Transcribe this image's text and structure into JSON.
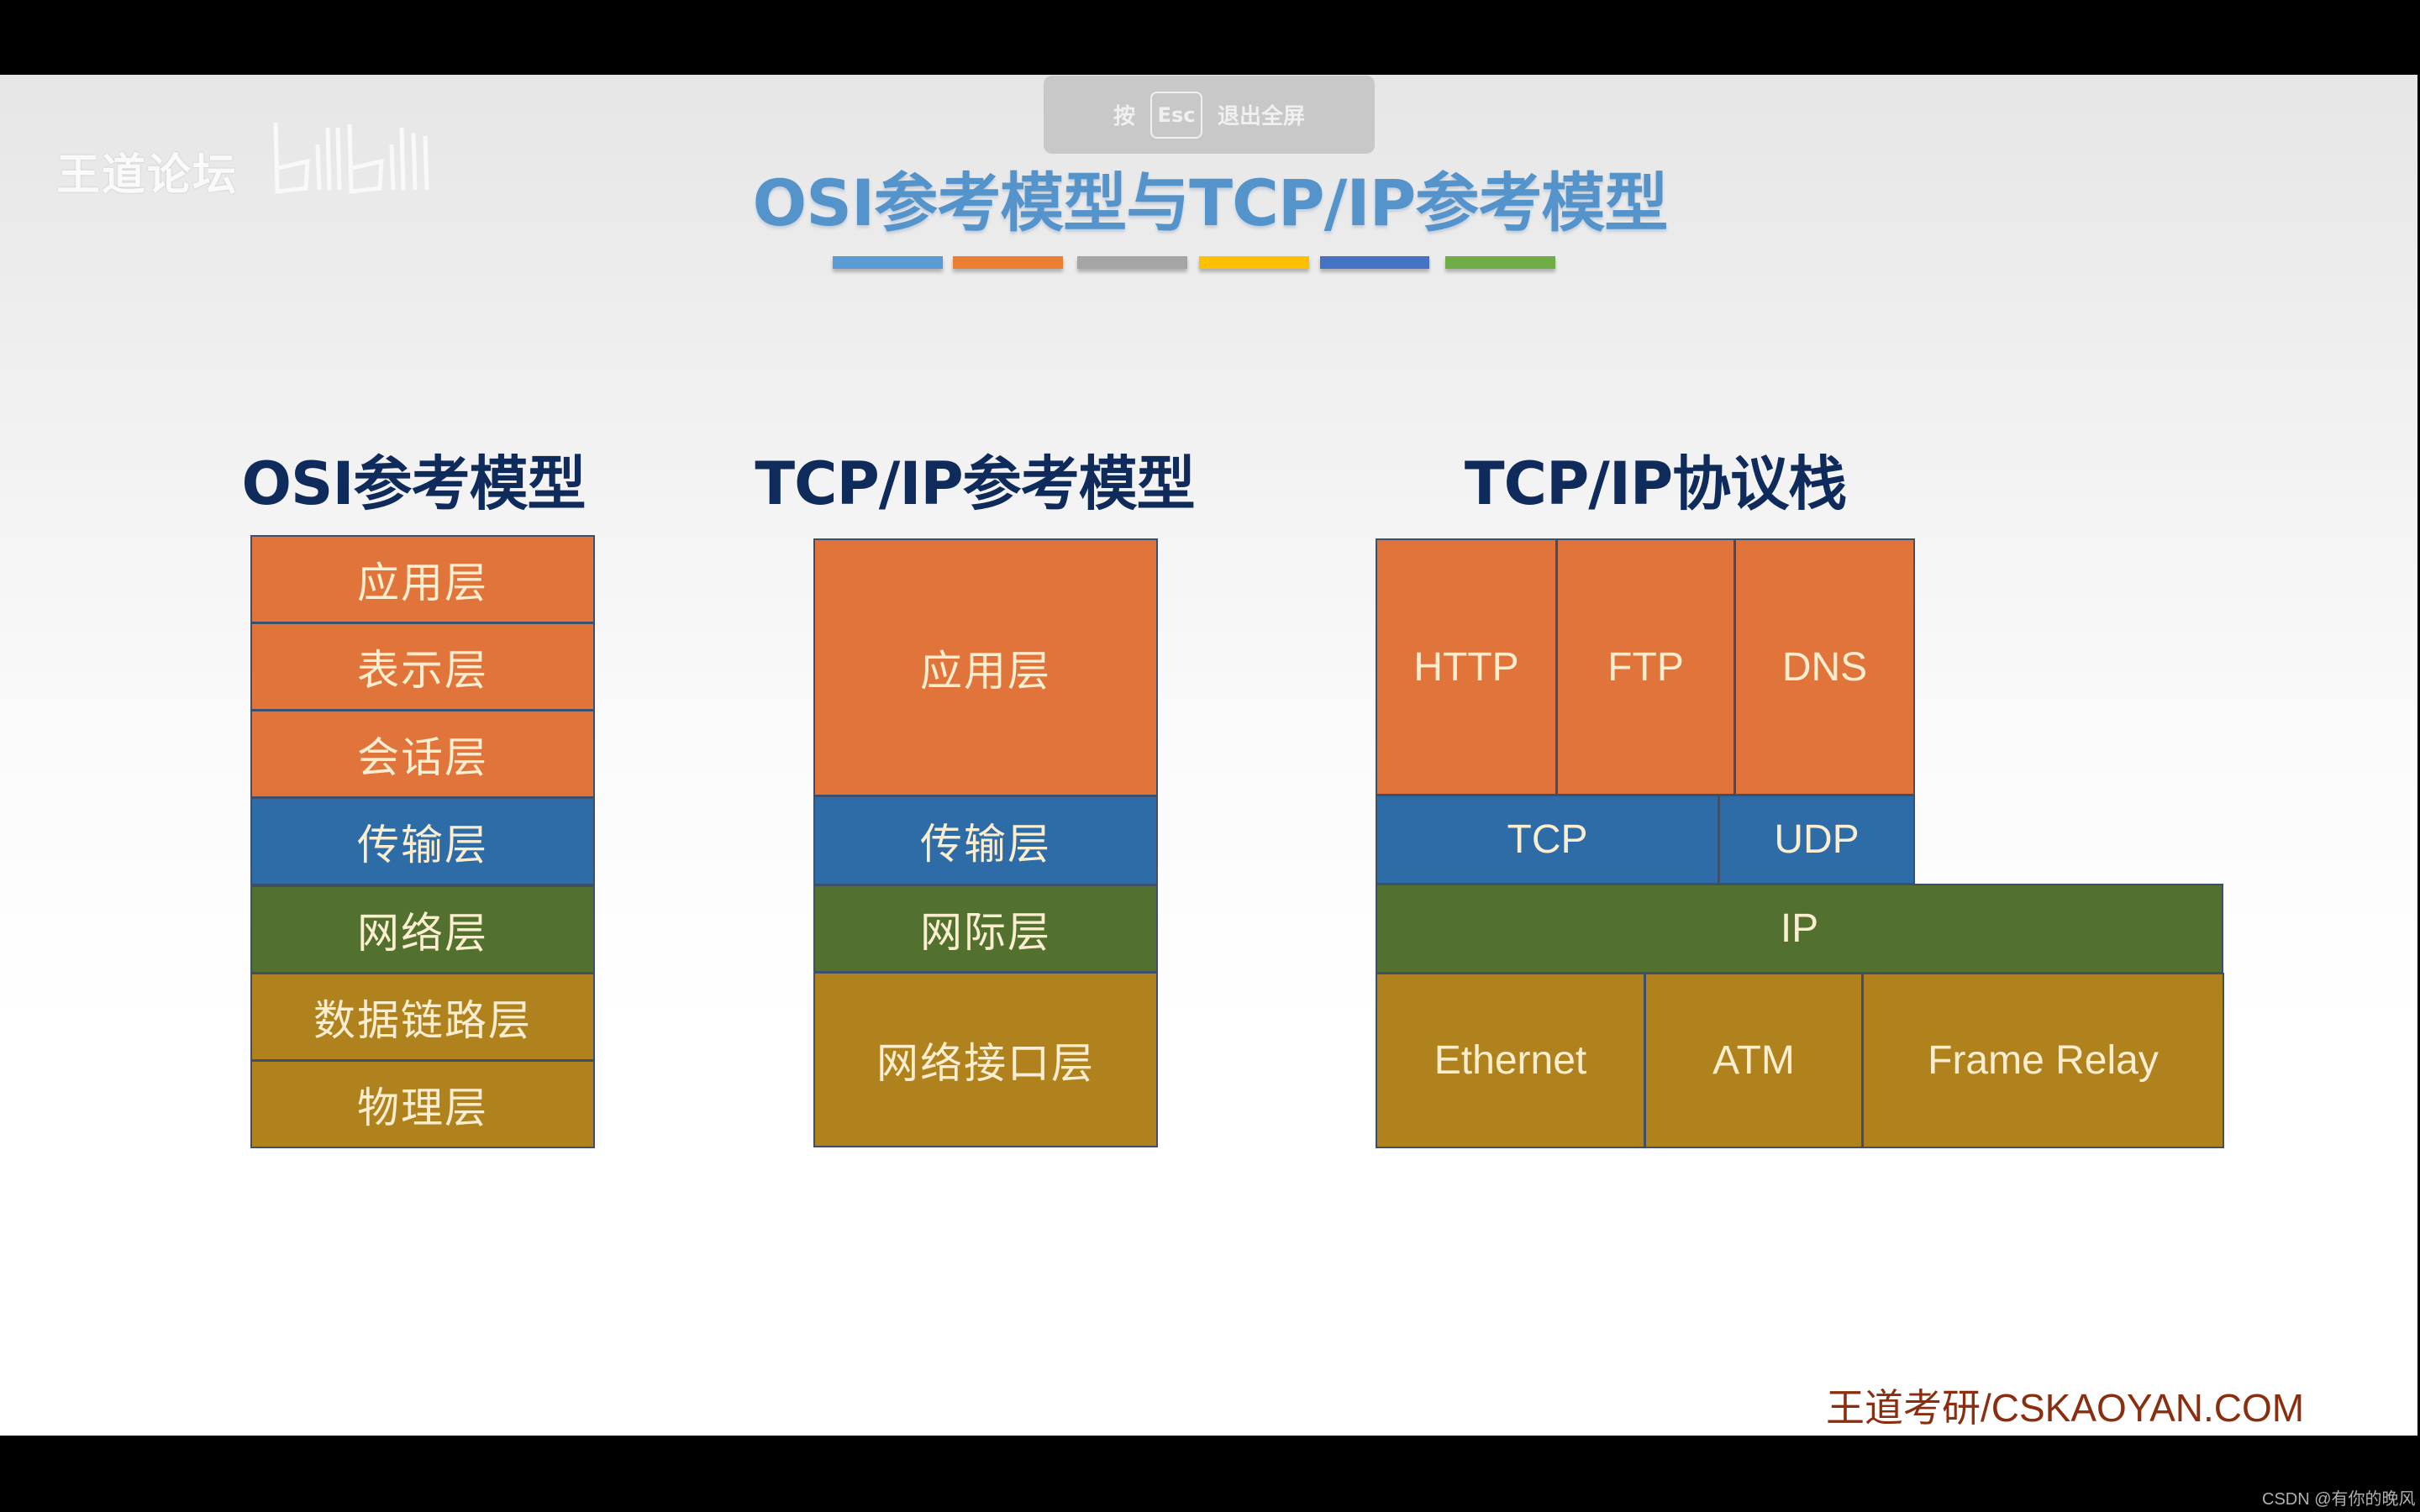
{
  "watermark": {
    "forum": "王道论坛",
    "logo_icon": "bilibili-logo"
  },
  "fullscreen_hint": {
    "prefix": "按",
    "key": "Esc",
    "suffix": "退出全屏"
  },
  "title": "OSI参考模型与TCP/IP参考模型",
  "accent_bars": [
    "#5b9bd5",
    "#ed7d31",
    "#a5a5a5",
    "#ffc000",
    "#4472c4",
    "#70ad47"
  ],
  "layer_colors": {
    "application": "#e0743a",
    "transport": "#2e6ca8",
    "network": "#52712f",
    "link": "#b0821d"
  },
  "osi": {
    "heading": "OSI参考模型",
    "layers": [
      {
        "label": "应用层",
        "group": "application"
      },
      {
        "label": "表示层",
        "group": "application"
      },
      {
        "label": "会话层",
        "group": "application"
      },
      {
        "label": "传输层",
        "group": "transport"
      },
      {
        "label": "网络层",
        "group": "network"
      },
      {
        "label": "数据链路层",
        "group": "link"
      },
      {
        "label": "物理层",
        "group": "link"
      }
    ]
  },
  "tcpip_model": {
    "heading": "TCP/IP参考模型",
    "layers": [
      {
        "label": "应用层",
        "group": "application"
      },
      {
        "label": "传输层",
        "group": "transport"
      },
      {
        "label": "网际层",
        "group": "network"
      },
      {
        "label": "网络接口层",
        "group": "link"
      }
    ]
  },
  "protocol_stack": {
    "heading": "TCP/IP协议栈",
    "application": [
      "HTTP",
      "FTP",
      "DNS"
    ],
    "transport": [
      "TCP",
      "UDP"
    ],
    "network": [
      "IP"
    ],
    "link": [
      "Ethernet",
      "ATM",
      "Frame Relay"
    ]
  },
  "footer": "王道考研/CSKAOYAN.COM",
  "csdn_watermark": "CSDN @有你的晚风"
}
